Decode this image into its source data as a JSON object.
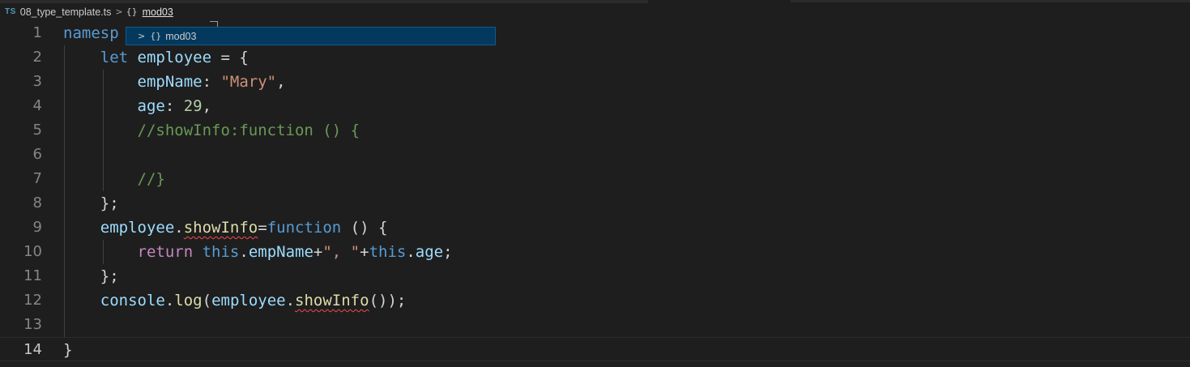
{
  "breadcrumb": {
    "file_icon": "TS",
    "file_name": "08_type_template.ts",
    "separator": ">",
    "namespace_icon": "{}",
    "namespace": "mod03"
  },
  "popup": {
    "chevron": ">",
    "icon": "{}",
    "label": "mod03"
  },
  "colors": {
    "background": "#1e1e1e",
    "keyword": "#569cd6",
    "control_keyword": "#c586c0",
    "variable": "#9cdcfe",
    "string": "#ce9178",
    "number": "#b5cea8",
    "comment": "#6a9955",
    "function": "#dcdcaa",
    "popup_bg": "#04395e"
  },
  "editor": {
    "current_line": 14,
    "lines": [
      {
        "num": "1",
        "tokens": [
          {
            "t": "namesp",
            "c": "kw"
          }
        ]
      },
      {
        "num": "2",
        "tokens": [
          {
            "t": "    "
          },
          {
            "t": "let",
            "c": "kw"
          },
          {
            "t": " "
          },
          {
            "t": "employee",
            "c": "var"
          },
          {
            "t": " = {"
          }
        ]
      },
      {
        "num": "3",
        "tokens": [
          {
            "t": "        "
          },
          {
            "t": "empName",
            "c": "var"
          },
          {
            "t": ": "
          },
          {
            "t": "\"Mary\"",
            "c": "str"
          },
          {
            "t": ","
          }
        ]
      },
      {
        "num": "4",
        "tokens": [
          {
            "t": "        "
          },
          {
            "t": "age",
            "c": "var"
          },
          {
            "t": ": "
          },
          {
            "t": "29",
            "c": "num"
          },
          {
            "t": ","
          }
        ]
      },
      {
        "num": "5",
        "tokens": [
          {
            "t": "        "
          },
          {
            "t": "//showInfo:function () {",
            "c": "cmt"
          }
        ]
      },
      {
        "num": "6",
        "tokens": []
      },
      {
        "num": "7",
        "tokens": [
          {
            "t": "        "
          },
          {
            "t": "//}",
            "c": "cmt"
          }
        ]
      },
      {
        "num": "8",
        "tokens": [
          {
            "t": "    };"
          }
        ]
      },
      {
        "num": "9",
        "tokens": [
          {
            "t": "    "
          },
          {
            "t": "employee",
            "c": "var"
          },
          {
            "t": "."
          },
          {
            "t": "showInfo",
            "c": "fn squig"
          },
          {
            "t": "="
          },
          {
            "t": "function",
            "c": "kw"
          },
          {
            "t": " () {"
          }
        ]
      },
      {
        "num": "10",
        "tokens": [
          {
            "t": "        "
          },
          {
            "t": "return",
            "c": "kw2"
          },
          {
            "t": " "
          },
          {
            "t": "this",
            "c": "kw"
          },
          {
            "t": "."
          },
          {
            "t": "empName",
            "c": "var"
          },
          {
            "t": "+"
          },
          {
            "t": "\", \"",
            "c": "str"
          },
          {
            "t": "+"
          },
          {
            "t": "this",
            "c": "kw"
          },
          {
            "t": "."
          },
          {
            "t": "age",
            "c": "var"
          },
          {
            "t": ";"
          }
        ]
      },
      {
        "num": "11",
        "tokens": [
          {
            "t": "    };"
          }
        ]
      },
      {
        "num": "12",
        "tokens": [
          {
            "t": "    "
          },
          {
            "t": "console",
            "c": "var"
          },
          {
            "t": "."
          },
          {
            "t": "log",
            "c": "fn"
          },
          {
            "t": "("
          },
          {
            "t": "employee",
            "c": "var"
          },
          {
            "t": "."
          },
          {
            "t": "showInfo",
            "c": "fn squig"
          },
          {
            "t": "());"
          }
        ]
      },
      {
        "num": "13",
        "tokens": []
      },
      {
        "num": "14",
        "tokens": [
          {
            "t": "}"
          }
        ]
      }
    ]
  }
}
